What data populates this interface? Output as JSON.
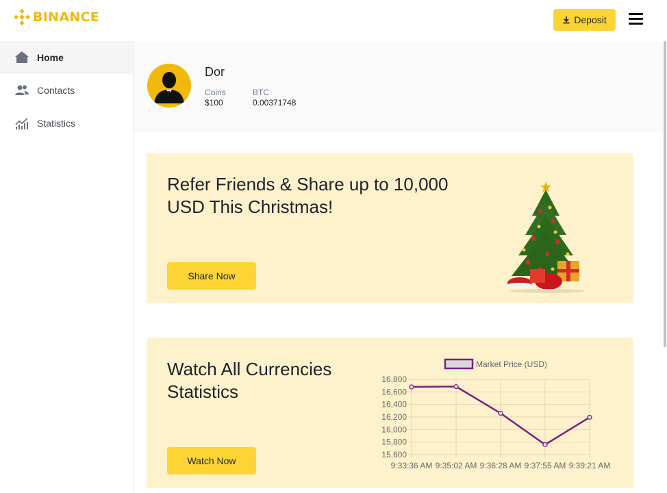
{
  "brand": {
    "name": "BINANCE",
    "color": "#f0b90b"
  },
  "header": {
    "deposit_label": "Deposit",
    "deposit_icon": "download-icon",
    "menu_icon": "hamburger-icon"
  },
  "sidebar": {
    "items": [
      {
        "label": "Home",
        "icon": "home-icon",
        "active": true
      },
      {
        "label": "Contacts",
        "icon": "contacts-icon",
        "active": false
      },
      {
        "label": "Statistics",
        "icon": "statistics-icon",
        "active": false
      }
    ]
  },
  "profile": {
    "name": "Dor",
    "coins_label": "Coins",
    "coins_value": "$100",
    "btc_label": "BTC",
    "btc_value": "0.00371748"
  },
  "promo": {
    "title": "Refer Friends & Share up to 10,000 USD This Christmas!",
    "button_label": "Share Now",
    "image": "christmas-tree"
  },
  "stats_card": {
    "title": "Watch All Currencies Statistics",
    "button_label": "Watch Now"
  },
  "chart_data": {
    "type": "line",
    "legend": "Market Price (USD)",
    "x": [
      "9:33:36 AM",
      "9:35:02 AM",
      "9:36:28 AM",
      "9:37:55 AM",
      "9:39:21 AM"
    ],
    "series": [
      {
        "name": "Market Price (USD)",
        "values": [
          16680,
          16685,
          16260,
          15760,
          16195
        ]
      }
    ],
    "yticks": [
      15600,
      15800,
      16000,
      16200,
      16400,
      16600,
      16800
    ],
    "ylim": [
      15600,
      16800
    ],
    "grid": true,
    "legend_position": "top",
    "colors": {
      "line": "#7b1f7e",
      "legend_fill": "#d9d9d9",
      "grid": "#e0d6b3"
    }
  },
  "colors": {
    "accent": "#fcd535",
    "card_bg": "#fef2cc",
    "profile_bg": "#fafafa"
  }
}
